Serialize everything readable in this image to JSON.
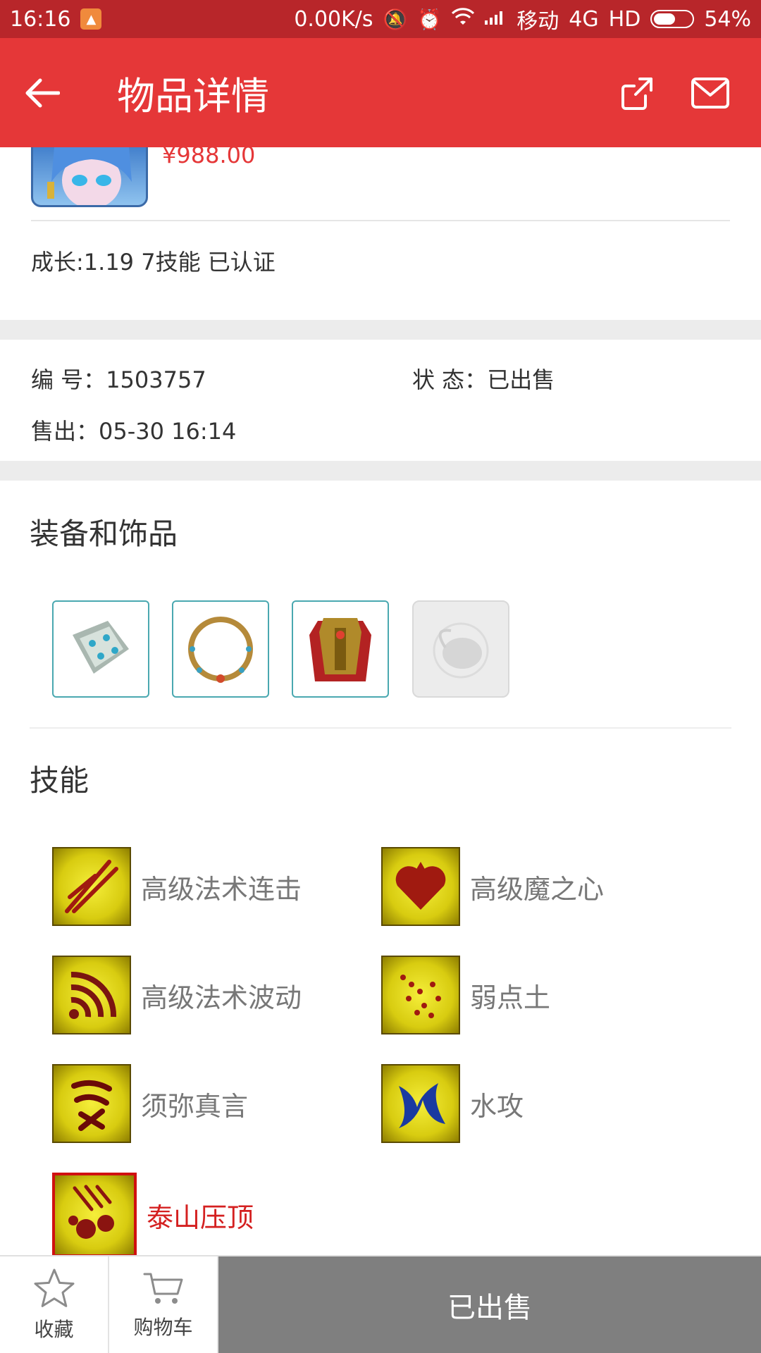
{
  "status_bar": {
    "time": "16:16",
    "speed": "0.00K/s",
    "carrier": "移动",
    "network": "4G",
    "hd": "HD",
    "battery": "54%",
    "battery_level": 0.54
  },
  "header": {
    "title": "物品详情",
    "back_icon": "arrow-left-icon",
    "share_icon": "share-icon",
    "mail_icon": "mail-icon"
  },
  "item": {
    "price": "¥988.00",
    "growth": "成长:1.19 7技能 已认证"
  },
  "info": {
    "id_label": "编  号：",
    "id_value": "1503757",
    "status_label": "状  态：",
    "status_value": "已出售",
    "sold_label": "售出：",
    "sold_value": "05-30 16:14"
  },
  "equipment": {
    "title": "装备和饰品",
    "items": [
      {
        "icon": "bracer-icon"
      },
      {
        "icon": "necklace-icon"
      },
      {
        "icon": "armor-icon"
      },
      {
        "icon": "empty-slot-icon"
      }
    ]
  },
  "skills": {
    "title": "技能",
    "items": [
      {
        "name": "高级法术连击",
        "icon": "spell-combo-icon"
      },
      {
        "name": "高级魔之心",
        "icon": "magic-heart-icon"
      },
      {
        "name": "高级法术波动",
        "icon": "spell-wave-icon"
      },
      {
        "name": "弱点土",
        "icon": "weak-earth-icon"
      },
      {
        "name": "须弥真言",
        "icon": "sumeru-mantra-icon"
      },
      {
        "name": "水攻",
        "icon": "water-attack-icon"
      },
      {
        "name": "泰山压顶",
        "icon": "mount-tai-icon",
        "active": true
      }
    ]
  },
  "bottom_bar": {
    "favorite_label": "收藏",
    "cart_label": "购物车",
    "sold_label": "已出售"
  },
  "colors": {
    "header": "#e53738",
    "status_bar": "#b8262a",
    "price": "#e53738",
    "sold_button": "#7f7f7f",
    "active_skill": "#d42020"
  }
}
